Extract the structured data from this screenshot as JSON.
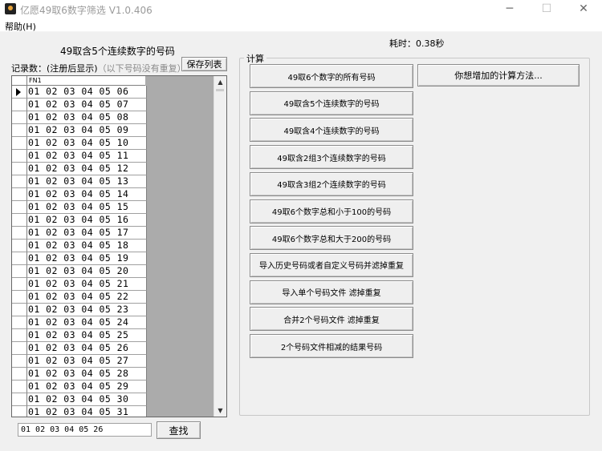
{
  "window": {
    "title": "亿愿49取6数字筛选 V1.0.406",
    "icons": {
      "minimize": "minimize-icon",
      "maximize": "maximize-icon",
      "close": "close-icon"
    }
  },
  "menu": {
    "help": "帮助(H)"
  },
  "left": {
    "title": "49取含5个连续数字的号码",
    "record_label": "记录数：(注册后显示)",
    "record_note": "（以下号码没有重复）",
    "save_button": "保存列表",
    "grid": {
      "column_header": "FN1",
      "rows": [
        "01 02 03 04 05 06",
        "01 02 03 04 05 07",
        "01 02 03 04 05 08",
        "01 02 03 04 05 09",
        "01 02 03 04 05 10",
        "01 02 03 04 05 11",
        "01 02 03 04 05 12",
        "01 02 03 04 05 13",
        "01 02 03 04 05 14",
        "01 02 03 04 05 15",
        "01 02 03 04 05 16",
        "01 02 03 04 05 17",
        "01 02 03 04 05 18",
        "01 02 03 04 05 19",
        "01 02 03 04 05 20",
        "01 02 03 04 05 21",
        "01 02 03 04 05 22",
        "01 02 03 04 05 23",
        "01 02 03 04 05 24",
        "01 02 03 04 05 25",
        "01 02 03 04 05 26",
        "01 02 03 04 05 27",
        "01 02 03 04 05 28",
        "01 02 03 04 05 29",
        "01 02 03 04 05 30",
        "01 02 03 04 05 31"
      ]
    },
    "search_value": "01 02 03 04 05 26",
    "search_button": "查找"
  },
  "elapsed": "耗时：0.38秒",
  "calc": {
    "legend": "计算",
    "buttons": [
      "49取6个数字的所有号码",
      "49取含5个连续数字的号码",
      "49取含4个连续数字的号码",
      "49取含2组3个连续数字的号码",
      "49取含3组2个连续数字的号码",
      "49取6个数字总和小于100的号码",
      "49取6个数字总和大于200的号码",
      "导入历史号码或者自定义号码并滤掉重复",
      "导入单个号码文件 滤掉重复",
      "合并2个号码文件 滤掉重复",
      "2个号码文件相减的结果号码"
    ],
    "extra_button": "你想增加的计算方法..."
  }
}
